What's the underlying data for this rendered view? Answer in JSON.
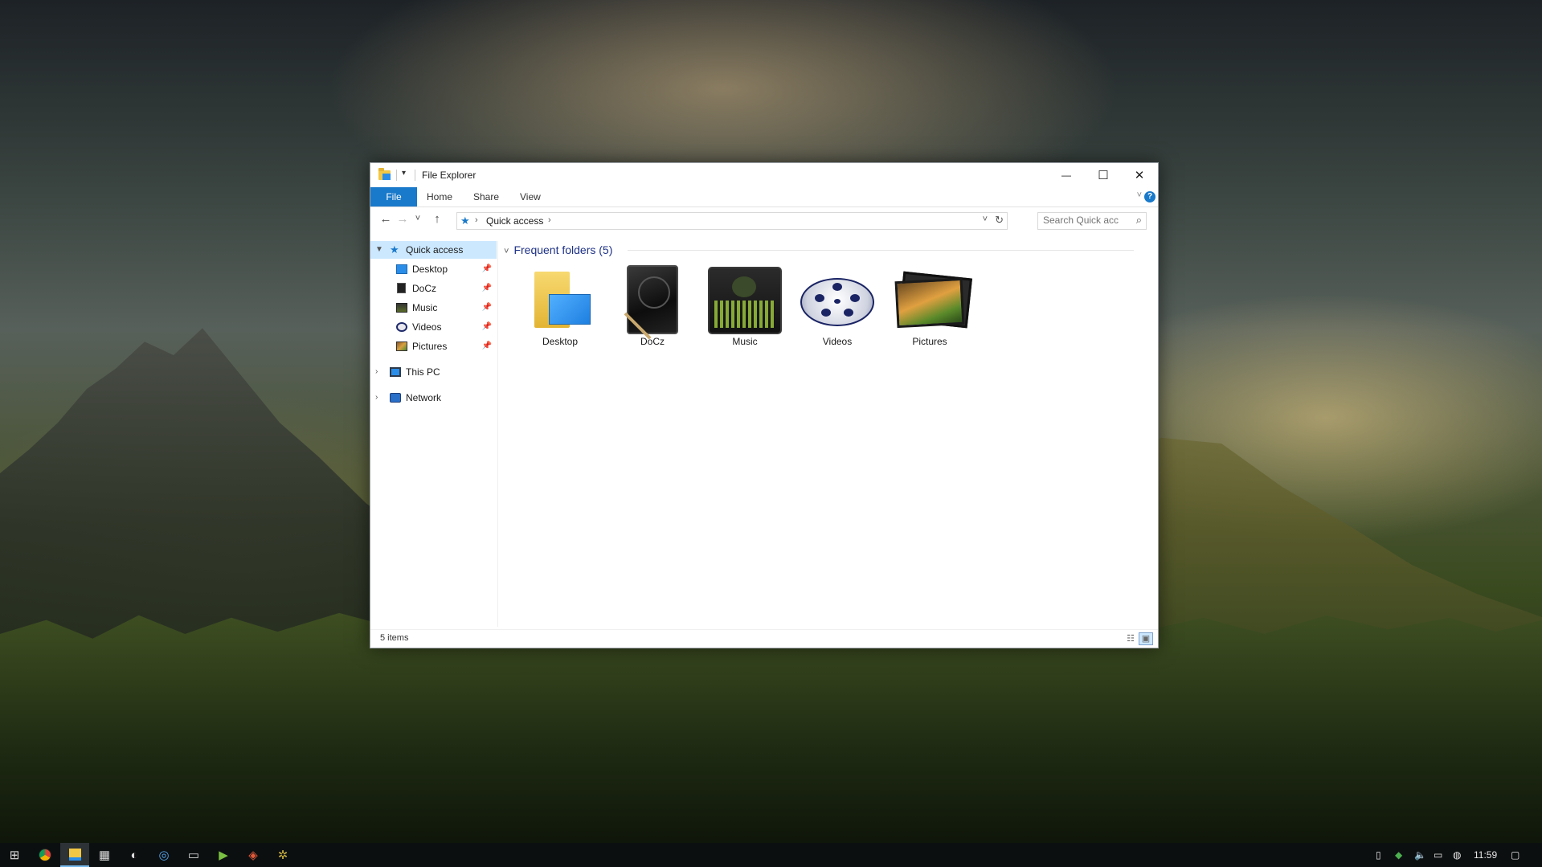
{
  "window": {
    "title": "File Explorer",
    "minimize_glyph": "—",
    "maximize_glyph": "☐",
    "close_glyph": "✕"
  },
  "ribbon": {
    "tabs": [
      "File",
      "Home",
      "Share",
      "View"
    ],
    "help_glyph": "?"
  },
  "navigation": {
    "back_glyph": "←",
    "forward_glyph": "→",
    "recent_glyph": "˅",
    "up_glyph": "↑",
    "address": {
      "location": "Quick access",
      "separator": "›"
    },
    "search": {
      "placeholder": "Search Quick acc"
    }
  },
  "nav_pane": {
    "quick_access": {
      "label": "Quick access",
      "items": [
        {
          "label": "Desktop",
          "icon": "desktop-icon"
        },
        {
          "label": "DoCz",
          "icon": "documents-icon"
        },
        {
          "label": "Music",
          "icon": "music-icon"
        },
        {
          "label": "Videos",
          "icon": "videos-icon"
        },
        {
          "label": "Pictures",
          "icon": "pictures-icon"
        }
      ]
    },
    "this_pc": "This PC",
    "network": "Network"
  },
  "content": {
    "group_title": "Frequent folders (5)",
    "folders": [
      {
        "label": "Desktop",
        "icon": "desktop-folder-icon"
      },
      {
        "label": "DoCz",
        "icon": "documents-folder-icon"
      },
      {
        "label": "Music",
        "icon": "music-folder-icon"
      },
      {
        "label": "Videos",
        "icon": "film-reel-icon"
      },
      {
        "label": "Pictures",
        "icon": "photo-stack-icon"
      }
    ]
  },
  "status": {
    "item_count": "5 items"
  },
  "taskbar": {
    "clock": "11:59"
  },
  "colors": {
    "accent": "#1979ca",
    "selection": "#cce8ff",
    "group_heading": "#1e3287"
  }
}
